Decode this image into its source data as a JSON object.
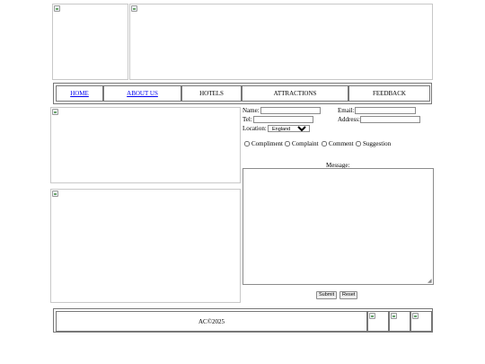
{
  "nav": {
    "items": [
      {
        "label": "HOME",
        "link": true
      },
      {
        "label": "ABOUT US",
        "link": true
      },
      {
        "label": "HOTELS",
        "link": false
      },
      {
        "label": "ATTRACTIONS",
        "link": false
      },
      {
        "label": "FEEDBACK",
        "link": false
      }
    ]
  },
  "form": {
    "name_label": "Name:",
    "email_label": "Email:",
    "tel_label": "Tel:",
    "address_label": "Address:",
    "location_label": "Location:",
    "location_value": "England",
    "checkboxes": [
      "Compliment",
      "Complaint",
      "Comment",
      "Suggestion"
    ],
    "message_label": "Message:",
    "submit_label": "Submit",
    "reset_label": "Reset"
  },
  "footer": {
    "copyright": "AC©2025"
  }
}
